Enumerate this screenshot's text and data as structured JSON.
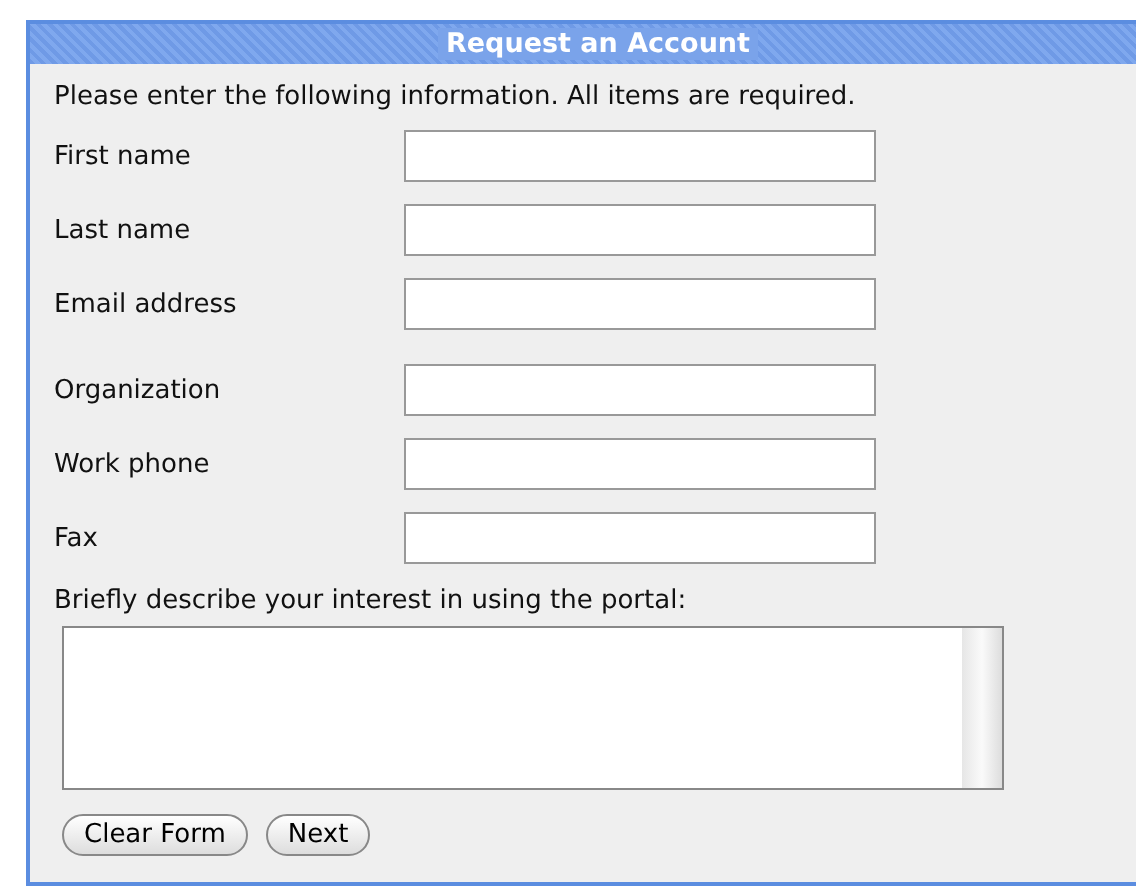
{
  "panel": {
    "title": "Request an Account"
  },
  "intro": "Please enter the following information. All items are required.",
  "fields": [
    {
      "label": "First name"
    },
    {
      "label": "Last name"
    },
    {
      "label": "Email address"
    },
    {
      "label": "Organization"
    },
    {
      "label": "Work phone"
    },
    {
      "label": "Fax"
    }
  ],
  "interest": {
    "label": "Briefly describe your interest in using the portal:"
  },
  "buttons": [
    {
      "label": "Clear Form"
    },
    {
      "label": "Next"
    }
  ]
}
